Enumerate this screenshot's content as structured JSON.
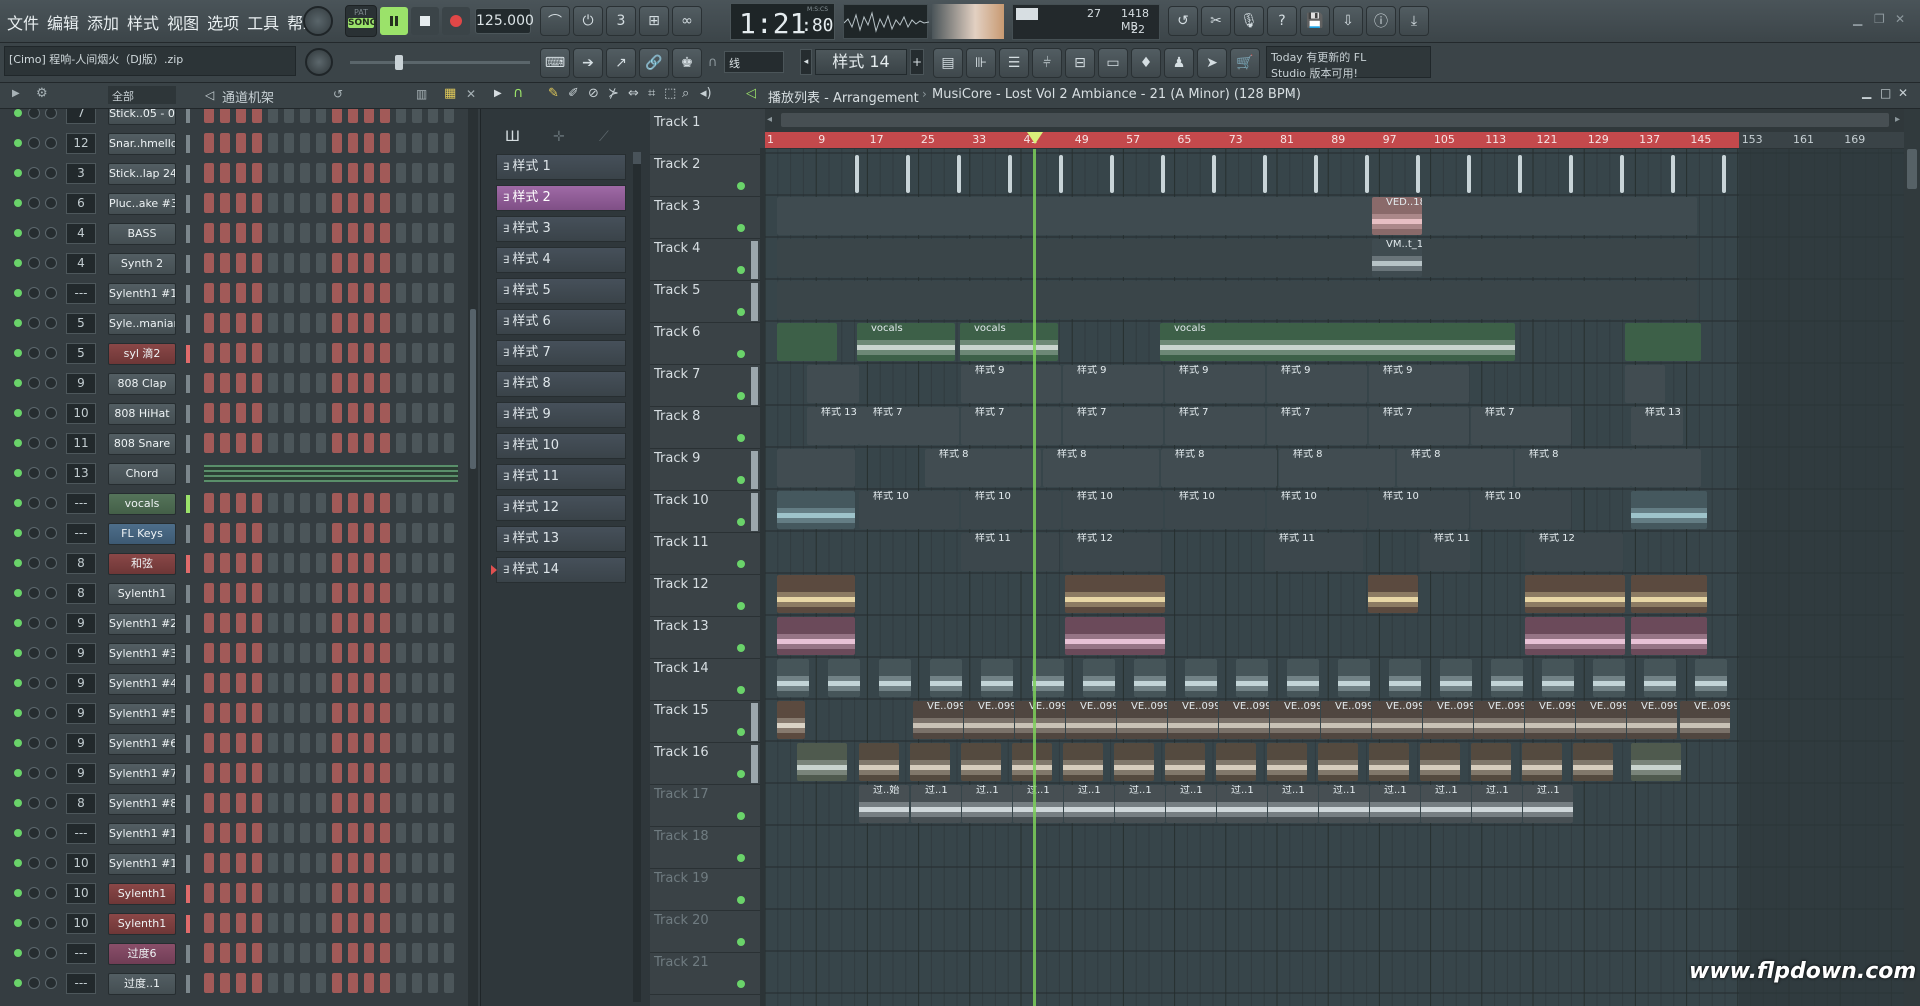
{
  "menu": [
    "文件",
    "编辑",
    "添加",
    "样式",
    "视图",
    "选项",
    "工具",
    "帮助"
  ],
  "transport": {
    "mode": "SONG",
    "pat": "PAT",
    "tempo": "125.000",
    "time": "1:21",
    "time_sub": ":80",
    "msc": "M:S:CS"
  },
  "monitor": {
    "cpu": "27",
    "mem": "1418 MB",
    "poly": "22"
  },
  "project": {
    "file": "[Cimo] 程响-人间烟火（DJ版）.zip"
  },
  "snap": {
    "label": "线",
    "pattern": "样式 14"
  },
  "news": {
    "line1": "Today 有更新的 FL",
    "line2": "Studio 版本可用!"
  },
  "rack": {
    "filter": "全部",
    "title": "通道机架",
    "channels": [
      {
        "num": "7",
        "name": "Stick..05 - 0",
        "color": "grey"
      },
      {
        "num": "12",
        "name": "Snar..hmello",
        "color": "grey"
      },
      {
        "num": "3",
        "name": "Stick..lap 24",
        "color": "grey"
      },
      {
        "num": "6",
        "name": "Pluc..ake #3",
        "color": "grey"
      },
      {
        "num": "4",
        "name": "BASS",
        "color": "grey"
      },
      {
        "num": "4",
        "name": "Synth 2",
        "color": "grey"
      },
      {
        "num": "---",
        "name": "Sylenth1 #12",
        "color": "grey"
      },
      {
        "num": "5",
        "name": "Syle..manian",
        "color": "grey"
      },
      {
        "num": "5",
        "name": "syl 滴2",
        "color": "red"
      },
      {
        "num": "9",
        "name": "808 Clap",
        "color": "grey"
      },
      {
        "num": "10",
        "name": "808 HiHat",
        "color": "grey"
      },
      {
        "num": "11",
        "name": "808 Snare",
        "color": "grey"
      },
      {
        "num": "13",
        "name": "Chord",
        "color": "grey"
      },
      {
        "num": "---",
        "name": "vocals",
        "color": "green"
      },
      {
        "num": "---",
        "name": "FL Keys",
        "color": "blue"
      },
      {
        "num": "8",
        "name": "和弦",
        "color": "red"
      },
      {
        "num": "8",
        "name": "Sylenth1",
        "color": "grey"
      },
      {
        "num": "9",
        "name": "Sylenth1 #2",
        "color": "grey"
      },
      {
        "num": "9",
        "name": "Sylenth1 #3",
        "color": "grey"
      },
      {
        "num": "9",
        "name": "Sylenth1 #4",
        "color": "grey"
      },
      {
        "num": "9",
        "name": "Sylenth1 #5",
        "color": "grey"
      },
      {
        "num": "9",
        "name": "Sylenth1 #6",
        "color": "grey"
      },
      {
        "num": "9",
        "name": "Sylenth1 #7",
        "color": "grey"
      },
      {
        "num": "8",
        "name": "Sylenth1 #8",
        "color": "grey"
      },
      {
        "num": "---",
        "name": "Sylenth1 #10",
        "color": "grey"
      },
      {
        "num": "10",
        "name": "Sylenth1 #11",
        "color": "grey"
      },
      {
        "num": "10",
        "name": "Sylenth1",
        "color": "red"
      },
      {
        "num": "10",
        "name": "Sylenth1",
        "color": "red"
      },
      {
        "num": "---",
        "name": "过度6",
        "color": "pink"
      },
      {
        "num": "---",
        "name": "过度..1",
        "color": "grey"
      }
    ]
  },
  "patterns": [
    "样式 1",
    "样式 2",
    "样式 3",
    "样式 4",
    "样式 5",
    "样式 6",
    "样式 7",
    "样式 8",
    "样式 9",
    "样式 10",
    "样式 11",
    "样式 12",
    "样式 13",
    "样式 14"
  ],
  "playlist": {
    "title": "播放列表 - Arrangement",
    "song": "MusiCore - Lost Vol 2 Ambiance - 21 (A Minor) (128 BPM)",
    "bars": [
      "1",
      "9",
      "17",
      "25",
      "33",
      "41",
      "49",
      "57",
      "65",
      "73",
      "81",
      "89",
      "97",
      "105",
      "113",
      "121",
      "129",
      "137",
      "145",
      "153",
      "161",
      "169"
    ],
    "tracks": [
      "Track 1",
      "Track 2",
      "Track 3",
      "Track 4",
      "Track 5",
      "Track 6",
      "Track 7",
      "Track 8",
      "Track 9",
      "Track 10",
      "Track 11",
      "Track 12",
      "Track 13",
      "Track 14",
      "Track 15",
      "Track 16",
      "Track 17",
      "Track 18",
      "Track 19",
      "Track 20",
      "Track 21"
    ],
    "clip_labels": {
      "vocals": "vocals",
      "ved": "VED..18",
      "vm": "VM..t_1",
      "p9": "样式 9",
      "p7": "样式 7",
      "p13": "样式 13",
      "p8": "样式 8",
      "p10": "样式 10",
      "p11": "样式 11",
      "p12": "样式 12",
      "ve": "VE..099",
      "guo1": "过..始",
      "guo": "过..1"
    }
  },
  "watermark": "www.flpdown.com",
  "colors": {
    "accent_green": "#9be26a",
    "timeline": "#c4494c",
    "pattern_sel": "#9f6aa6"
  }
}
